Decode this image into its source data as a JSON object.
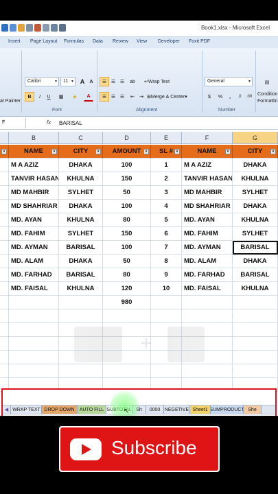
{
  "window": {
    "title": "Book1.xlsx - Microsoft Excel"
  },
  "ribbon": {
    "tabs": [
      "Insert",
      "Page Layout",
      "Formulas",
      "Data",
      "Review",
      "View",
      "Developer",
      "Foxit PDF"
    ],
    "font_name": "Calibri",
    "font_size": "11",
    "bold": "B",
    "italic": "I",
    "underline": "U",
    "grow_font": "A",
    "shrink_font": "A",
    "font_color": "A",
    "format_painter": "at Painter",
    "wrap_text": "Wrap Text",
    "merge_center": "Merge & Center",
    "number_format": "General",
    "percent": "%",
    "comma": ",",
    "dec_inc": ".0",
    "dec_dec": ".00",
    "conditional": "Condition",
    "formatting": "Formattin",
    "groups": {
      "font": "Font",
      "alignment": "Alignment",
      "number": "Number"
    }
  },
  "formula_bar": {
    "name_box": "F",
    "fx": "fx",
    "content": "BARISAL"
  },
  "columns": [
    "B",
    "C",
    "D",
    "E",
    "F",
    "G"
  ],
  "table": {
    "headers": [
      "NAME",
      "CITY",
      "AMOUNT",
      "SL #",
      "NAME",
      "CITY"
    ],
    "rows": [
      [
        "M A AZIZ",
        "DHAKA",
        "100",
        "1",
        "M A AZIZ",
        "DHAKA"
      ],
      [
        "TANVIR HASAN",
        "KHULNA",
        "150",
        "2",
        "TANVIR HASAN",
        "KHULNA"
      ],
      [
        "MD MAHBIR",
        "SYLHET",
        "50",
        "3",
        "MD MAHBIR",
        "SYLHET"
      ],
      [
        "MD SHAHRIAR",
        "DHAKA",
        "100",
        "4",
        "MD SHAHRIAR",
        "DHAKA"
      ],
      [
        "MD. AYAN",
        "KHULNA",
        "80",
        "5",
        "MD. AYAN",
        "KHULNA"
      ],
      [
        "MD. FAHIM",
        "SYLHET",
        "150",
        "6",
        "MD. FAHIM",
        "SYLHET"
      ],
      [
        "MD. AYMAN",
        "BARISAL",
        "100",
        "7",
        "MD. AYMAN",
        "BARISAL"
      ],
      [
        "MD. ALAM",
        "DHAKA",
        "50",
        "8",
        "MD. ALAM",
        "DHAKA"
      ],
      [
        "MD. FARHAD",
        "BARISAL",
        "80",
        "9",
        "MD. FARHAD",
        "BARISAL"
      ],
      [
        "MD. FAISAL",
        "KHULNA",
        "120",
        "10",
        "MD. FAISAL",
        "KHULNA"
      ]
    ],
    "total": "980"
  },
  "sheet_tabs": [
    {
      "label": "WRAP TEXT",
      "color": "#dfe6ef"
    },
    {
      "label": "DROP DOWN",
      "color": "#e7a66a"
    },
    {
      "label": "AUTO FILL",
      "color": "#b9d99a"
    },
    {
      "label": "SUBTOTAL",
      "color": "#ffffff"
    },
    {
      "label": "Sh",
      "color": "#dfe6ef"
    },
    {
      "label": "0000",
      "color": "#dfe6ef"
    },
    {
      "label": "NEGETIVE",
      "color": "#dfe6ef"
    },
    {
      "label": "Sheet1",
      "color": "#f1d36a"
    },
    {
      "label": "SUMPRODUCT",
      "color": "#c9d9f0"
    },
    {
      "label": "She",
      "color": "#f2c9a0"
    }
  ],
  "subscribe": {
    "label": "Subscribe"
  },
  "colors": {
    "header_fill": "#e46c1b",
    "highlight_border": "#e0101b",
    "subscribe_red": "#df1414"
  }
}
